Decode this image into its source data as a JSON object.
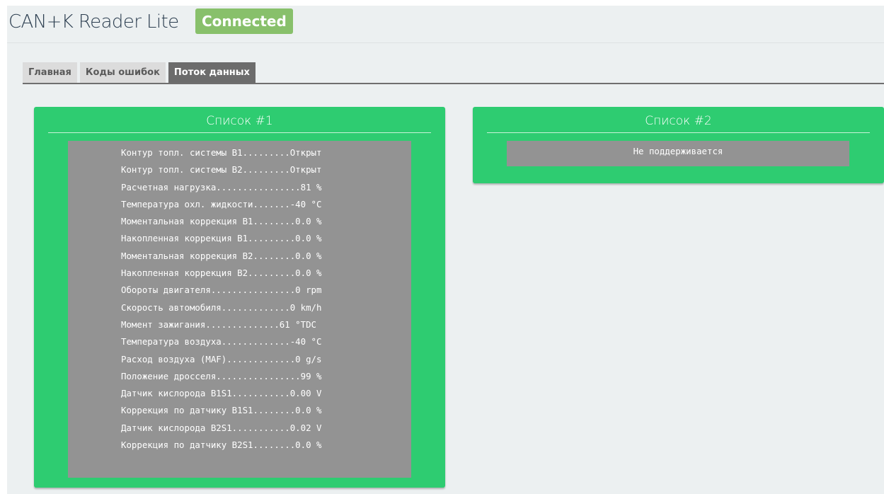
{
  "header": {
    "app_title": "CAN+K Reader Lite",
    "status": "Connected",
    "status_color": "#88c06b"
  },
  "tabs": [
    {
      "label": "Главная",
      "active": false
    },
    {
      "label": "Коды ошибок",
      "active": false
    },
    {
      "label": "Поток данных",
      "active": true
    }
  ],
  "colors": {
    "panel_bg": "#2ecc71",
    "data_box_bg": "#939393",
    "active_tab_bg": "#6c6c6c"
  },
  "list1": {
    "title": "Список #1",
    "rows": [
      "Контур топл. системы B1.........Открыт",
      "Контур топл. системы B2.........Открыт",
      "Расчетная нагрузка................81 %",
      "Температура охл. жидкости.......-40 °C",
      "Моментальная коррекция B1........0.0 %",
      "Накопленная коррекция B1.........0.0 %",
      "Моментальная коррекция B2........0.0 %",
      "Накопленная коррекция B2.........0.0 %",
      "Обороты двигателя................0 rpm",
      "Скорость автомобиля.............0 km/h",
      "Момент зажигания..............61 °TDC",
      "Температура воздуха.............-40 °C",
      "Расход воздуха (MAF).............0 g/s",
      "Положение дросселя................99 %",
      "Датчик кислорода B1S1...........0.00 V",
      "Коррекция по датчику B1S1........0.0 %",
      "Датчик кислорода B2S1...........0.02 V",
      "Коррекция по датчику B2S1........0.0 %"
    ]
  },
  "list2": {
    "title": "Список #2",
    "message": "Не поддерживается"
  }
}
